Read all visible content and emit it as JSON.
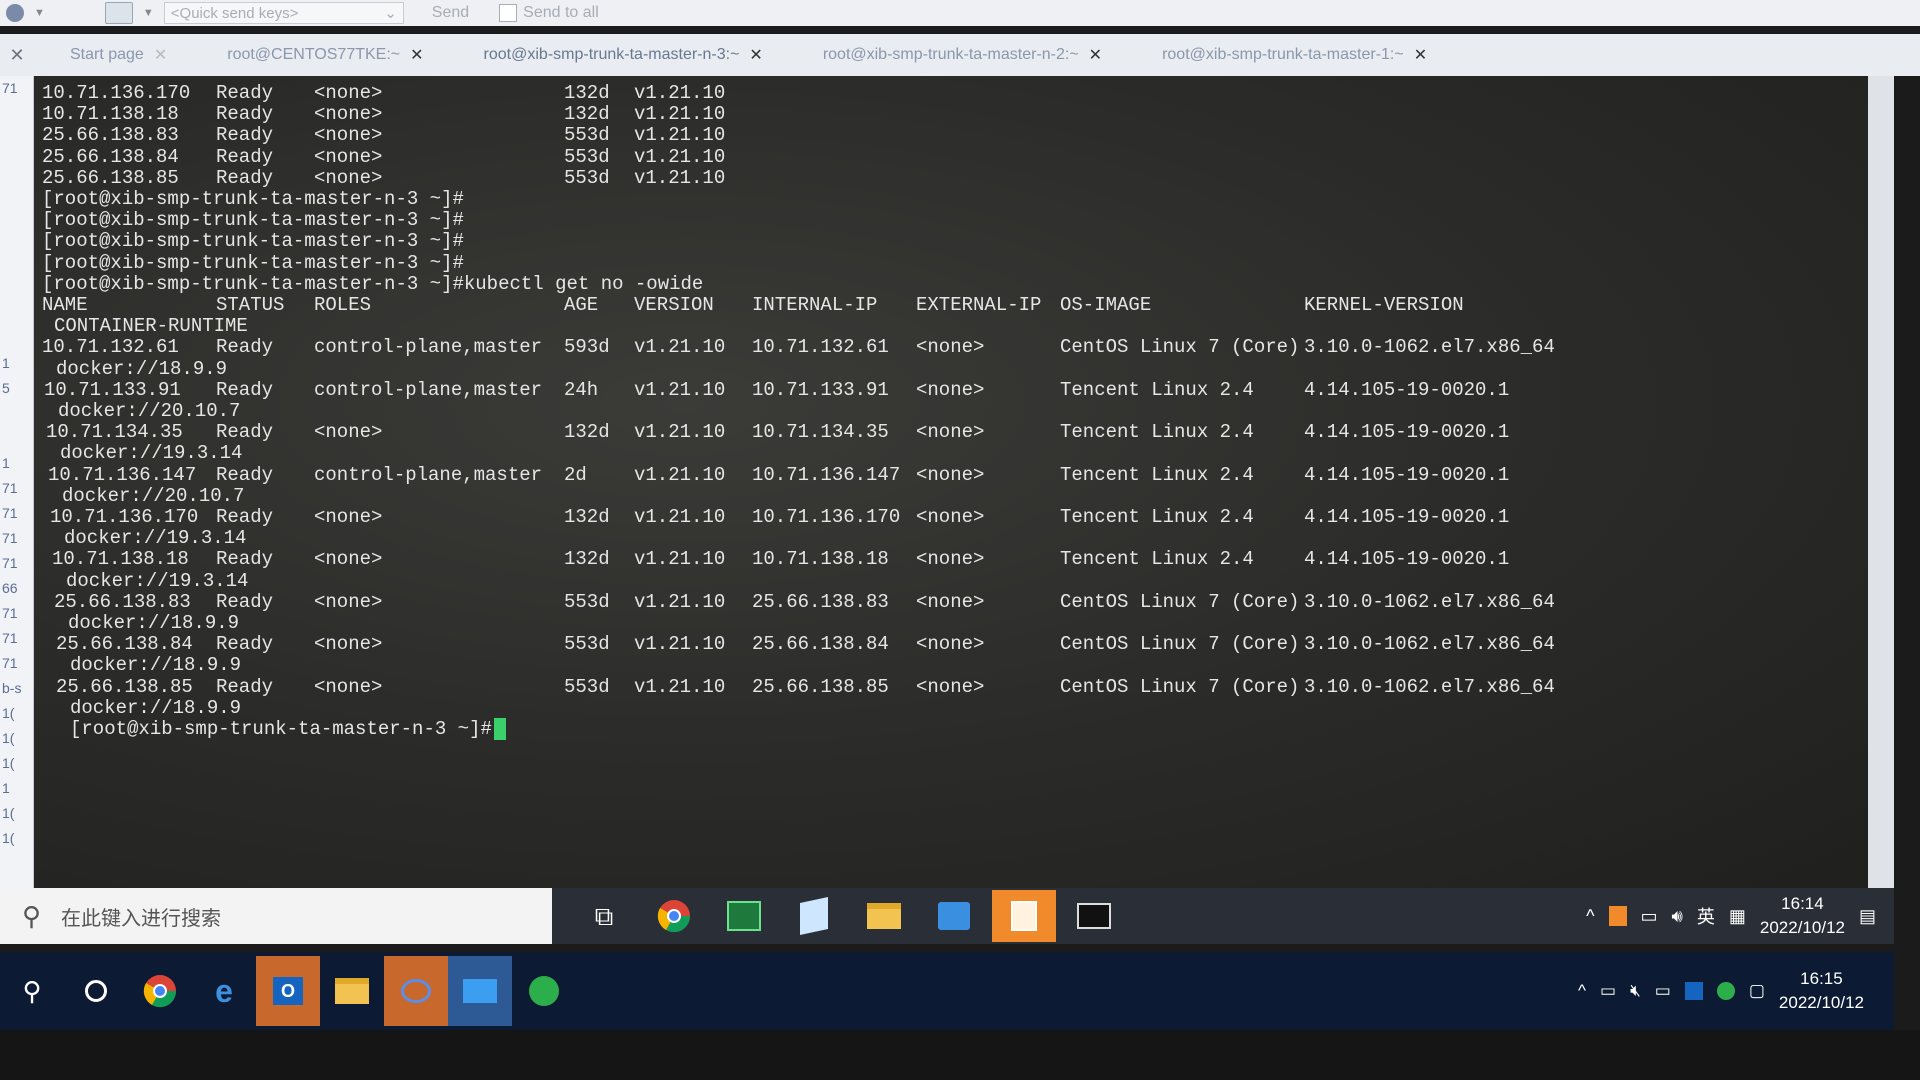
{
  "toolbar": {
    "quick_send_placeholder": "<Quick send keys>",
    "send_label": "Send",
    "send_to_all_label": "Send to all"
  },
  "tabs": [
    {
      "label": "Start page"
    },
    {
      "label": "root@CENTOS77TKE:~"
    },
    {
      "label": "root@xib-smp-trunk-ta-master-n-3:~"
    },
    {
      "label": "root@xib-smp-trunk-ta-master-n-2:~"
    },
    {
      "label": "root@xib-smp-trunk-ta-master-1:~"
    }
  ],
  "left_panel": [
    "71",
    "",
    "",
    "",
    "",
    "",
    "",
    "",
    "",
    "",
    "",
    "1",
    "5",
    "",
    "",
    "1",
    "71",
    "71",
    "71",
    "71",
    "66",
    "71",
    "71",
    "71",
    "b-s",
    "1(",
    "1(",
    "1(",
    "1",
    "1(",
    "1(",
    ""
  ],
  "terminal": {
    "prev_rows": [
      {
        "name": "10.71.136.170",
        "status": "Ready",
        "roles": "<none>",
        "age": "132d",
        "version": "v1.21.10"
      },
      {
        "name": "10.71.138.18",
        "status": "Ready",
        "roles": "<none>",
        "age": "132d",
        "version": "v1.21.10"
      },
      {
        "name": "25.66.138.83",
        "status": "Ready",
        "roles": "<none>",
        "age": "553d",
        "version": "v1.21.10"
      },
      {
        "name": "25.66.138.84",
        "status": "Ready",
        "roles": "<none>",
        "age": "553d",
        "version": "v1.21.10"
      },
      {
        "name": "25.66.138.85",
        "status": "Ready",
        "roles": "<none>",
        "age": "553d",
        "version": "v1.21.10"
      }
    ],
    "prompts": [
      "[root@xib-smp-trunk-ta-master-n-3 ~]#",
      "[root@xib-smp-trunk-ta-master-n-3 ~]#",
      "[root@xib-smp-trunk-ta-master-n-3 ~]#",
      "[root@xib-smp-trunk-ta-master-n-3 ~]#"
    ],
    "command_line": "[root@xib-smp-trunk-ta-master-n-3 ~]#kubectl get no -owide",
    "headers": {
      "name": "NAME",
      "status": "STATUS",
      "roles": "ROLES",
      "age": "AGE",
      "version": "VERSION",
      "internal_ip": "INTERNAL-IP",
      "external_ip": "EXTERNAL-IP",
      "os_image": "OS-IMAGE",
      "kernel": "KERNEL-VERSION",
      "runtime": "CONTAINER-RUNTIME"
    },
    "nodes": [
      {
        "name": "10.71.132.61",
        "status": "Ready",
        "roles": "control-plane,master",
        "age": "593d",
        "version": "v1.21.10",
        "internal_ip": "10.71.132.61",
        "external_ip": "<none>",
        "os_image": "CentOS Linux 7 (Core)",
        "kernel": "3.10.0-1062.el7.x86_64",
        "runtime": "docker://18.9.9"
      },
      {
        "name": "10.71.133.91",
        "status": "Ready",
        "roles": "control-plane,master",
        "age": "24h",
        "version": "v1.21.10",
        "internal_ip": "10.71.133.91",
        "external_ip": "<none>",
        "os_image": "Tencent Linux 2.4",
        "kernel": "4.14.105-19-0020.1",
        "runtime": "docker://20.10.7"
      },
      {
        "name": "10.71.134.35",
        "status": "Ready",
        "roles": "<none>",
        "age": "132d",
        "version": "v1.21.10",
        "internal_ip": "10.71.134.35",
        "external_ip": "<none>",
        "os_image": "Tencent Linux 2.4",
        "kernel": "4.14.105-19-0020.1",
        "runtime": "docker://19.3.14"
      },
      {
        "name": "10.71.136.147",
        "status": "Ready",
        "roles": "control-plane,master",
        "age": "2d",
        "version": "v1.21.10",
        "internal_ip": "10.71.136.147",
        "external_ip": "<none>",
        "os_image": "Tencent Linux 2.4",
        "kernel": "4.14.105-19-0020.1",
        "runtime": "docker://20.10.7"
      },
      {
        "name": "10.71.136.170",
        "status": "Ready",
        "roles": "<none>",
        "age": "132d",
        "version": "v1.21.10",
        "internal_ip": "10.71.136.170",
        "external_ip": "<none>",
        "os_image": "Tencent Linux 2.4",
        "kernel": "4.14.105-19-0020.1",
        "runtime": "docker://19.3.14"
      },
      {
        "name": "10.71.138.18",
        "status": "Ready",
        "roles": "<none>",
        "age": "132d",
        "version": "v1.21.10",
        "internal_ip": "10.71.138.18",
        "external_ip": "<none>",
        "os_image": "Tencent Linux 2.4",
        "kernel": "4.14.105-19-0020.1",
        "runtime": "docker://19.3.14"
      },
      {
        "name": "25.66.138.83",
        "status": "Ready",
        "roles": "<none>",
        "age": "553d",
        "version": "v1.21.10",
        "internal_ip": "25.66.138.83",
        "external_ip": "<none>",
        "os_image": "CentOS Linux 7 (Core)",
        "kernel": "3.10.0-1062.el7.x86_64",
        "runtime": "docker://18.9.9"
      },
      {
        "name": "25.66.138.84",
        "status": "Ready",
        "roles": "<none>",
        "age": "553d",
        "version": "v1.21.10",
        "internal_ip": "25.66.138.84",
        "external_ip": "<none>",
        "os_image": "CentOS Linux 7 (Core)",
        "kernel": "3.10.0-1062.el7.x86_64",
        "runtime": "docker://18.9.9"
      },
      {
        "name": "25.66.138.85",
        "status": "Ready",
        "roles": "<none>",
        "age": "553d",
        "version": "v1.21.10",
        "internal_ip": "25.66.138.85",
        "external_ip": "<none>",
        "os_image": "CentOS Linux 7 (Core)",
        "kernel": "3.10.0-1062.el7.x86_64",
        "runtime": "docker://18.9.9"
      }
    ],
    "final_prompt": "[root@xib-smp-trunk-ta-master-n-3 ~]#"
  },
  "taskbar_inner": {
    "search_placeholder": "在此键入进行搜索",
    "ime_label": "英",
    "time": "16:14",
    "date": "2022/10/12"
  },
  "taskbar_outer": {
    "time": "16:15",
    "date": "2022/10/12"
  },
  "colors": {
    "terminal_text": "#e6e6e6",
    "cursor": "#3ad16b",
    "taskbar_highlight": "#f08a2a"
  }
}
